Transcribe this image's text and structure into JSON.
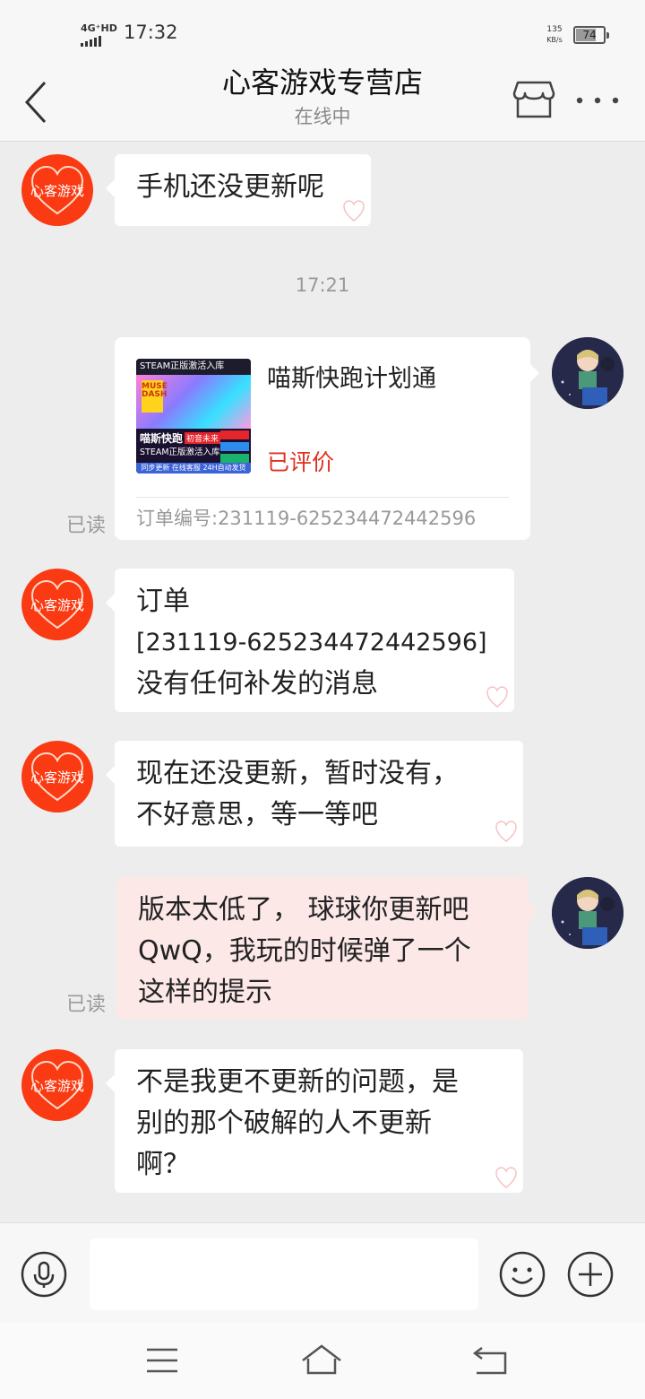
{
  "status_bar": {
    "network": "4G⁺HD",
    "time": "17:32",
    "speed_value": "135",
    "speed_unit": "KB/s",
    "battery": "74",
    "battery_level_pct": 74
  },
  "header": {
    "title": "心客游戏专营店",
    "subtitle": "在线中",
    "back_icon": "chevron-left-icon",
    "store_icon": "store-icon",
    "more_icon": "more-icon"
  },
  "colors": {
    "shop_avatar": "#fa3a12",
    "price_red": "#e0301e",
    "user_bubble": "#fde8e8",
    "background": "#ededed"
  },
  "messages": {
    "m1_text": "手机还没更新呢",
    "time_separator": "17:21",
    "product_card": {
      "name": "喵斯快跑计划通",
      "status": "已评价",
      "order_line": "订单编号:231119-6252344724425​96",
      "read": "已读",
      "thumb": {
        "top": "STEAM正版激活入库",
        "logo": "MUSE DASH",
        "title": "喵斯快跑",
        "tag": "初音未来",
        "subtitle": "STEAM正版激活入库",
        "footer": "同步更新 在线客服 24H自动发货"
      }
    },
    "m2_line1": "订单",
    "m2_line2": "[231119-6252344724425​96]",
    "m2_line3": "没有任何补发的消息",
    "m3_line1": "现在还没更新，暂时没有，",
    "m3_line2": "不好意思，等一等吧",
    "m4_line1": "版本太低了， 球球你更新吧",
    "m4_line2": "QwQ，我玩的时候弹了一个",
    "m4_line3": "这样的提示",
    "m4_read": "已读",
    "m5_line1": "不是我更不更新的问题，是",
    "m5_line2": "别的那个破解的人不更新",
    "m5_line3": "啊？",
    "shop_avatar_text": "心客游戏"
  },
  "input_bar": {
    "placeholder": "",
    "voice_icon": "microphone-icon",
    "emoji_icon": "emoji-icon",
    "plus_icon": "plus-icon"
  },
  "nav_bar": {
    "menu_icon": "menu-icon",
    "home_icon": "home-icon",
    "back_icon": "back-icon"
  }
}
